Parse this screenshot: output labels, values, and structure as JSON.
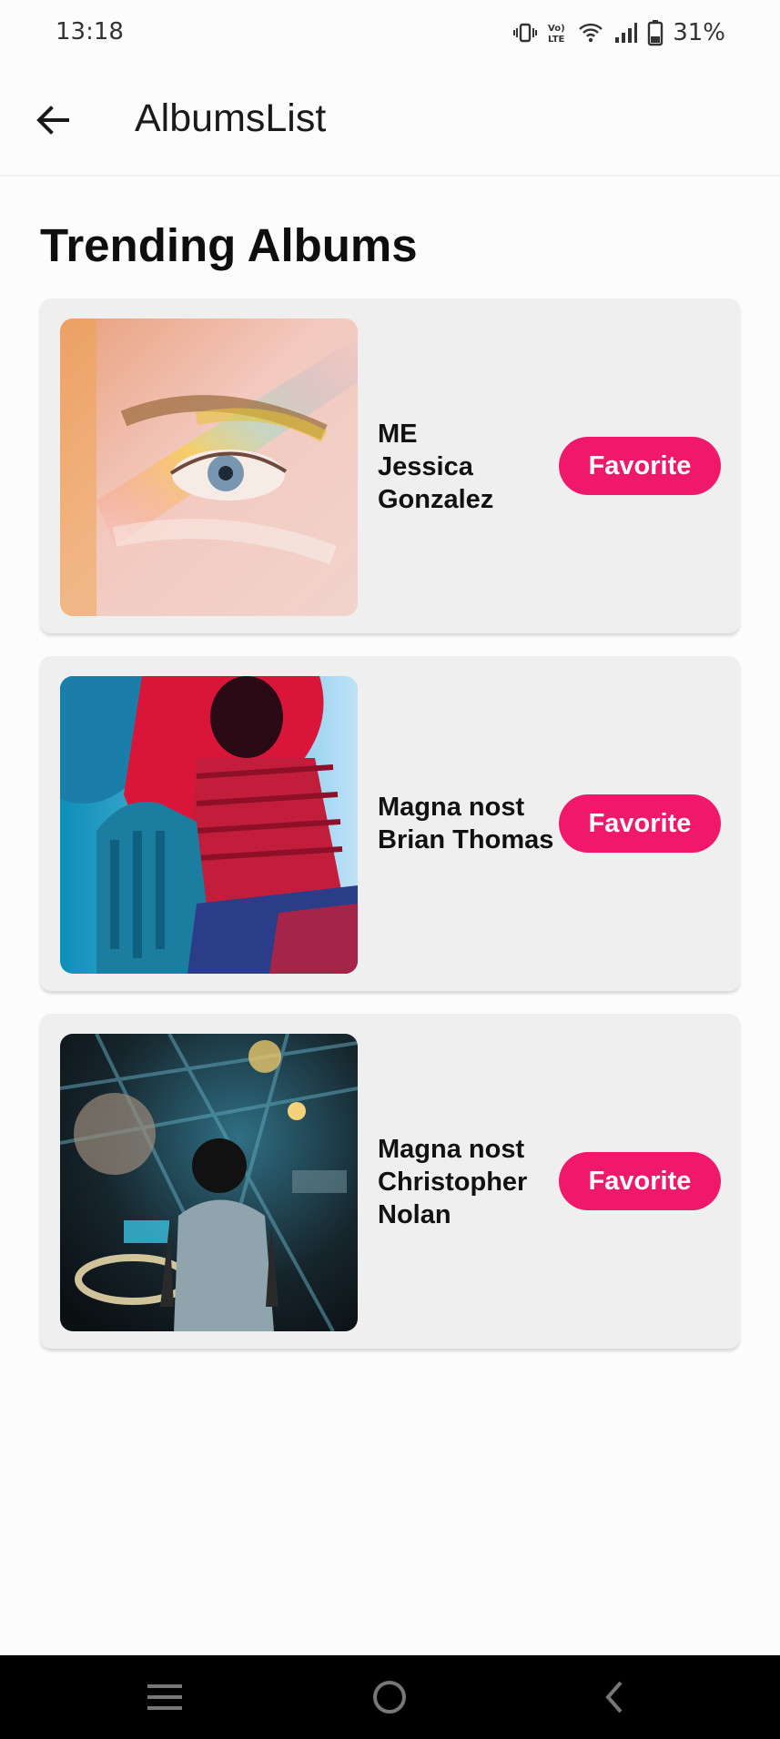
{
  "status_bar": {
    "time": "13:18",
    "battery_percent": "31%",
    "icons": [
      "vibrate-icon",
      "volte-icon",
      "wifi-icon",
      "signal-icon",
      "battery-icon"
    ]
  },
  "app_bar": {
    "title": "AlbumsList",
    "back_icon": "arrow-left-icon"
  },
  "section": {
    "title": "Trending Albums"
  },
  "albums": [
    {
      "title": "ME",
      "artist_line1": "Jessica",
      "artist_line2": "Gonzalez",
      "button_label": "Favorite"
    },
    {
      "title": "Magna nost",
      "artist_line1": "Brian Thomas",
      "artist_line2": "",
      "button_label": "Favorite"
    },
    {
      "title": "Magna nost",
      "artist_line1": "Christopher",
      "artist_line2": "Nolan",
      "button_label": "Favorite"
    }
  ],
  "colors": {
    "accent": "#f0186b",
    "card_background": "#f0eff0",
    "page_background": "#fdfcfd",
    "nav_bar": "#000000"
  },
  "nav_bar": {
    "icons": [
      "menu-icon",
      "home-icon",
      "back-chevron-icon"
    ]
  }
}
